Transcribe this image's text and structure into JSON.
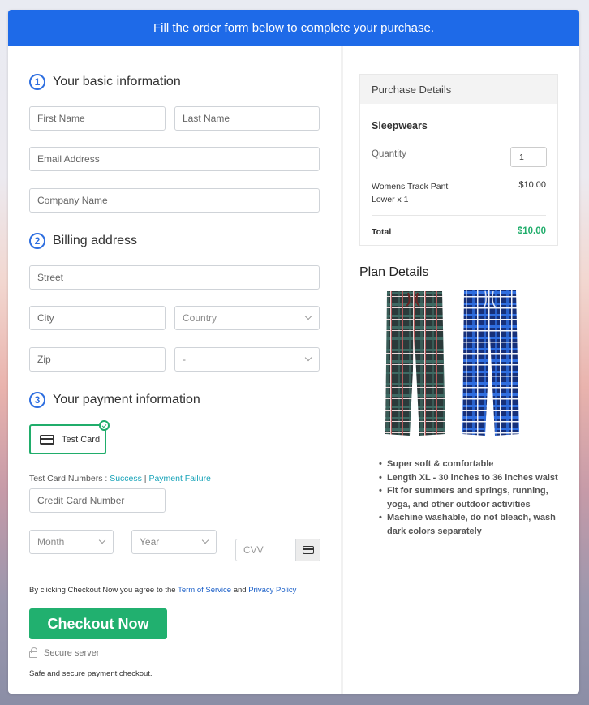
{
  "banner": {
    "text": "Fill the order form below to complete your purchase."
  },
  "sections": {
    "basic": {
      "number": "1",
      "title": "Your basic information"
    },
    "billing": {
      "number": "2",
      "title": "Billing address"
    },
    "payment": {
      "number": "3",
      "title": "Your payment information"
    }
  },
  "fields": {
    "first_name": "First Name",
    "last_name": "Last Name",
    "email": "Email Address",
    "company": "Company Name",
    "street": "Street",
    "city": "City",
    "country": "Country",
    "zip": "Zip",
    "state": "-",
    "card_number": "Credit Card Number",
    "month": "Month",
    "year": "Year",
    "cvv": "CVV"
  },
  "payment": {
    "method_label": "Test Card",
    "method_selected": true,
    "test_numbers_label": "Test Card Numbers : ",
    "success_link": "Success",
    "separator": " | ",
    "failure_link": "Payment Failure"
  },
  "agreement": {
    "prefix": "By clicking Checkout Now you agree to the ",
    "terms_link": "Term of Service",
    "and": " and ",
    "privacy_link": "Privacy Policy"
  },
  "checkout": {
    "button_label": "Checkout Now",
    "secure_label": "Secure server",
    "safe_text": "Safe and secure payment checkout."
  },
  "purchase": {
    "heading": "Purchase Details",
    "product": "Sleepwears",
    "quantity_label": "Quantity",
    "quantity_value": "1",
    "item_name": "Womens Track Pant Lower x 1",
    "item_price": "$10.00",
    "total_label": "Total",
    "total_value": "$10.00"
  },
  "plan": {
    "title": "Plan Details",
    "images": [
      "plaid-pants-green-red",
      "plaid-pants-blue-white"
    ],
    "features": [
      "Super soft & comfortable",
      "Length XL - 30 inches to 36 inches waist",
      "Fit for summers and springs, running, yoga, and other outdoor activities",
      "Machine washable, do not bleach, wash dark colors separately"
    ]
  },
  "colors": {
    "brand_blue": "#1e6ae8",
    "checkout_green": "#21b06f",
    "total_green": "#20ad6b",
    "link_teal": "#17a3b8",
    "link_blue": "#1a5fc8"
  }
}
